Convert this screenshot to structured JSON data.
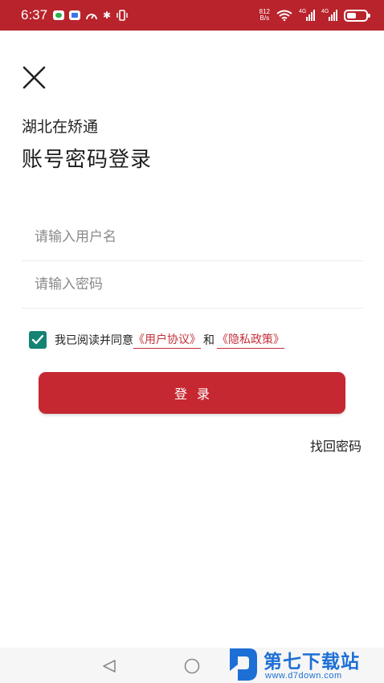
{
  "status_bar": {
    "time": "6:37",
    "net_speed_value": "812",
    "net_speed_unit": "B/s",
    "signal_1_label": "4G",
    "signal_2_label": "4G",
    "battery_level": 0.5,
    "background_color": "#b8232c",
    "icons": [
      "wechat-icon",
      "app-notification-icon",
      "gauge-icon",
      "bluetooth-icon",
      "vibrate-icon",
      "wifi-icon",
      "signal-icon",
      "battery-icon"
    ]
  },
  "header": {
    "close_icon": "close-icon",
    "app_name": "湖北在矫通",
    "title": "账号密码登录"
  },
  "form": {
    "username_placeholder": "请输入用户名",
    "username_value": "",
    "password_placeholder": "请输入密码",
    "password_value": ""
  },
  "agreement": {
    "checked": true,
    "prefix": "我已阅读并同意",
    "user_agreement": "《用户协议》",
    "and": "和",
    "privacy_policy": "《隐私政策》",
    "checkbox_color": "#138373",
    "link_color": "#c4303a"
  },
  "login_button": {
    "label": "登录",
    "color": "#c62831"
  },
  "forgot_password": "找回密码",
  "nav_bar": {
    "icons": [
      "back-triangle-icon",
      "home-circle-icon"
    ]
  },
  "watermark": {
    "title": "第七下载站",
    "url": "www.d7down.com",
    "color": "#1d6fd6"
  }
}
